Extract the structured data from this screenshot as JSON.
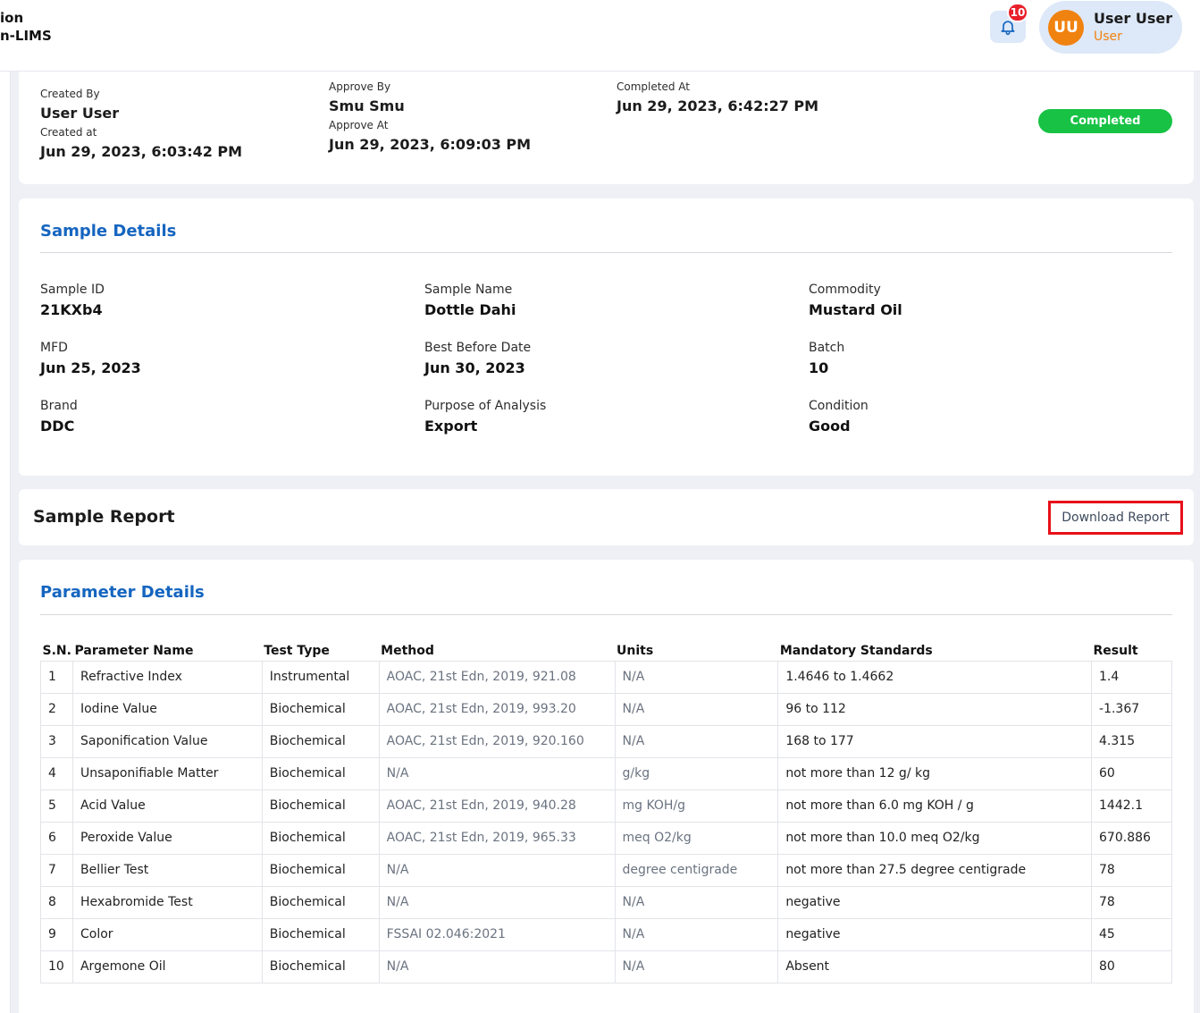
{
  "header": {
    "brand_line1": "ion",
    "brand_line2": "n-LIMS",
    "notification_count": "10",
    "avatar_initials": "UU",
    "user_name": "User User",
    "user_role": "User"
  },
  "summary": {
    "created_by_label": "Created By",
    "created_by_value": "User User",
    "created_at_label": "Created at",
    "created_at_value": "Jun 29, 2023, 6:03:42 PM",
    "approve_by_label": "Approve By",
    "approve_by_value": "Smu Smu",
    "approve_at_label": "Approve At",
    "approve_at_value": "Jun 29, 2023, 6:09:03 PM",
    "completed_at_label": "Completed At",
    "completed_at_value": "Jun 29, 2023, 6:42:27 PM",
    "status": "Completed",
    "status_color": "#18c245"
  },
  "sample_details": {
    "title": "Sample Details",
    "fields": [
      {
        "label": "Sample ID",
        "value": "21KXb4"
      },
      {
        "label": "Sample Name",
        "value": "Dottle Dahi"
      },
      {
        "label": "Commodity",
        "value": "Mustard Oil"
      },
      {
        "label": "MFD",
        "value": "Jun 25, 2023"
      },
      {
        "label": "Best Before Date",
        "value": "Jun 30, 2023"
      },
      {
        "label": "Batch",
        "value": "10"
      },
      {
        "label": "Brand",
        "value": "DDC"
      },
      {
        "label": "Purpose of Analysis",
        "value": "Export"
      },
      {
        "label": "Condition",
        "value": "Good"
      }
    ]
  },
  "sample_report": {
    "title": "Sample Report",
    "download_label": "Download Report"
  },
  "parameter_details": {
    "title": "Parameter Details",
    "columns": [
      "S.N.",
      "Parameter Name",
      "Test Type",
      "Method",
      "Units",
      "Mandatory Standards",
      "Result"
    ],
    "rows": [
      [
        "1",
        "Refractive Index",
        "Instrumental",
        "AOAC, 21st Edn, 2019, 921.08",
        "N/A",
        "1.4646 to 1.4662",
        "1.4"
      ],
      [
        "2",
        "Iodine Value",
        "Biochemical",
        "AOAC, 21st Edn, 2019, 993.20",
        "N/A",
        "96 to 112",
        "-1.367"
      ],
      [
        "3",
        "Saponification Value",
        "Biochemical",
        "AOAC, 21st Edn, 2019, 920.160",
        "N/A",
        "168 to 177",
        "4.315"
      ],
      [
        "4",
        "Unsaponifiable Matter",
        "Biochemical",
        "N/A",
        "g/kg",
        "not more than 12 g/ kg",
        "60"
      ],
      [
        "5",
        "Acid Value",
        "Biochemical",
        "AOAC, 21st Edn, 2019, 940.28",
        "mg KOH/g",
        "not more than 6.0 mg KOH / g",
        "1442.1"
      ],
      [
        "6",
        "Peroxide Value",
        "Biochemical",
        "AOAC, 21st Edn, 2019, 965.33",
        "meq O2/kg",
        "not more than 10.0 meq O2/kg",
        "670.886"
      ],
      [
        "7",
        "Bellier Test",
        "Biochemical",
        "N/A",
        "degree centigrade",
        "not more than 27.5 degree centigrade",
        "78"
      ],
      [
        "8",
        "Hexabromide Test",
        "Biochemical",
        "N/A",
        "N/A",
        "negative",
        "78"
      ],
      [
        "9",
        "Color",
        "Biochemical",
        "FSSAI 02.046:2021",
        "N/A",
        "negative",
        "45"
      ],
      [
        "10",
        "Argemone Oil",
        "Biochemical",
        "N/A",
        "N/A",
        "Absent",
        "80"
      ]
    ]
  },
  "colors": {
    "accent_blue": "#1565c0",
    "avatar_orange": "#f0820f",
    "badge_red": "#e8202a",
    "highlight_red": "#e8101a"
  }
}
